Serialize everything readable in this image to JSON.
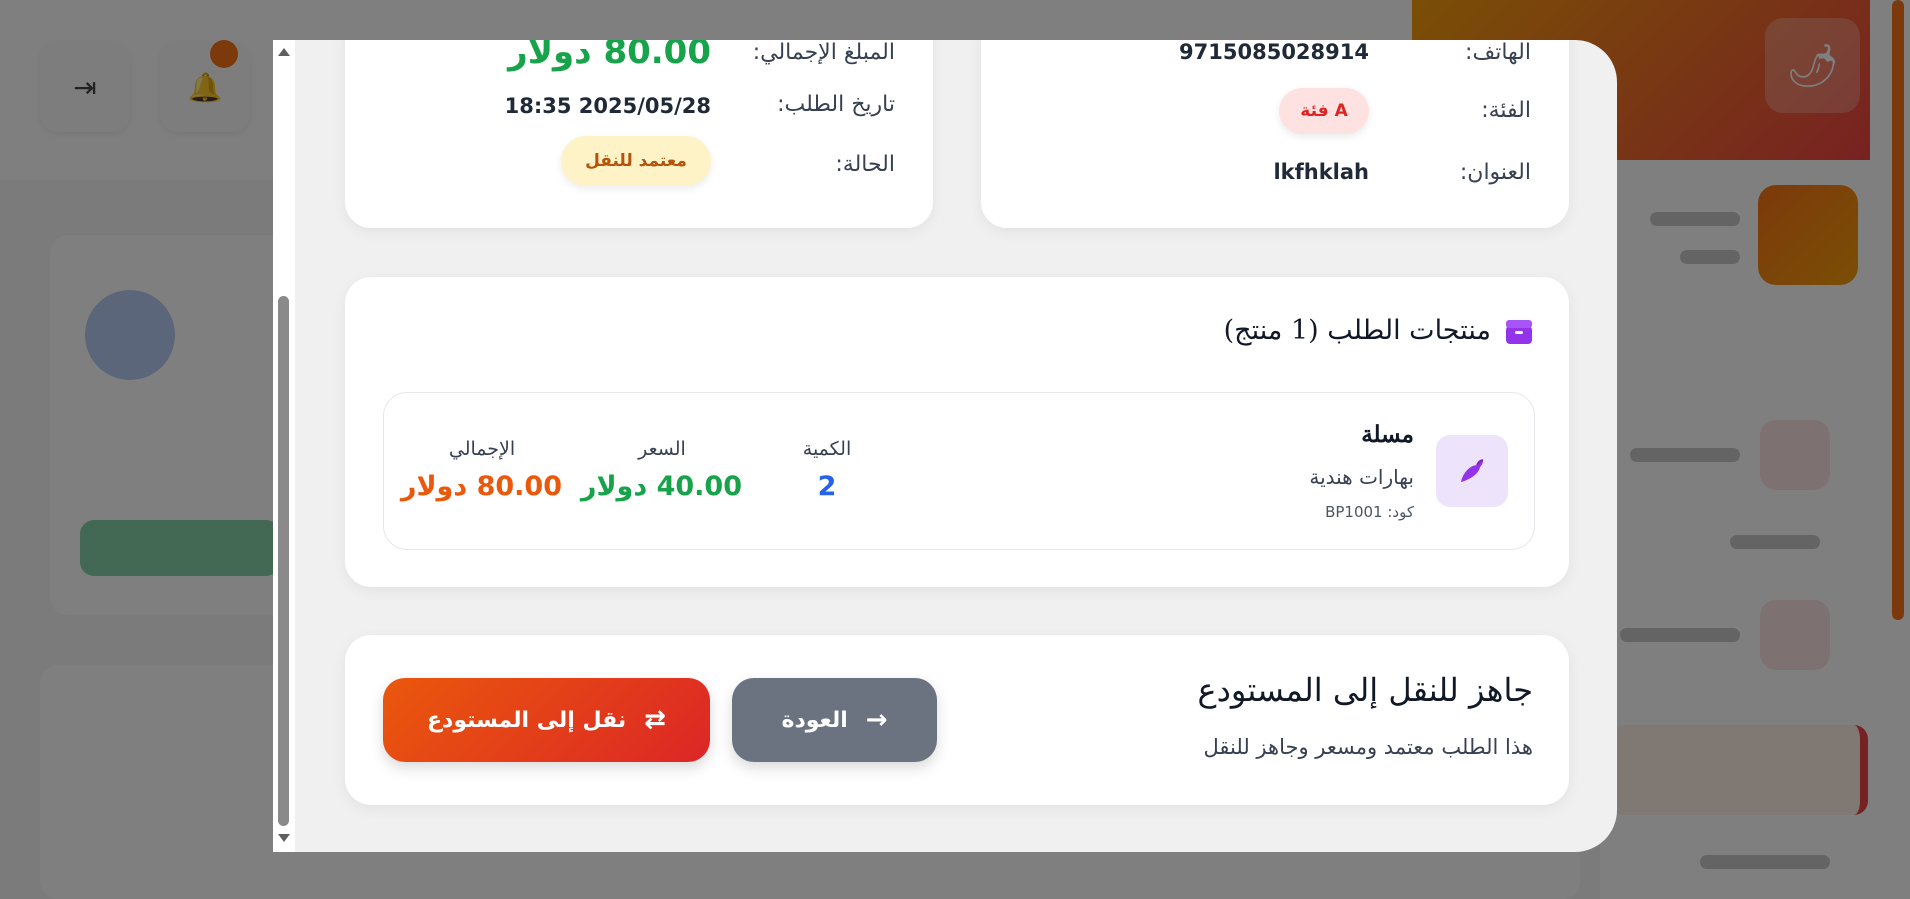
{
  "order_info": {
    "total_label": "المبلغ الإجمالي:",
    "total_value": "80.00 دولار",
    "date_label": "تاريخ الطلب:",
    "date_value": "18:35 2025/05/28",
    "status_label": "الحالة:",
    "status_badge": "معتمد للنقل"
  },
  "customer_info": {
    "phone_label": "الهاتف:",
    "phone_value": "9715085028914",
    "category_label": "الفئة:",
    "category_badge": "فئة A",
    "address_label": "العنوان:",
    "address_value": "lkfhklah"
  },
  "products": {
    "title": "منتجات الطلب (1 منتج)",
    "items": [
      {
        "name": "مسلة",
        "category": "بهارات هندية",
        "code": "كود: BP1001",
        "quantity_label": "الكمية",
        "quantity": "2",
        "price_label": "السعر",
        "price": "40.00 دولار",
        "total_label": "الإجمالي",
        "total": "80.00 دولار"
      }
    ]
  },
  "action": {
    "title": "جاهز للنقل إلى المستودع",
    "subtitle": "هذا الطلب معتمد ومسعر وجاهز للنقل",
    "back_label": "العودة",
    "transfer_label": "نقل إلى المستودع"
  },
  "colors": {
    "green": "#16a34a",
    "orange": "#ea580c",
    "blue": "#2563eb",
    "purple": "#9333ea",
    "status_bg": "#fef3c7",
    "status_text": "#b45309",
    "category_bg": "#fee2e2",
    "category_text": "#dc2626",
    "back_btn": "#6b7280"
  }
}
